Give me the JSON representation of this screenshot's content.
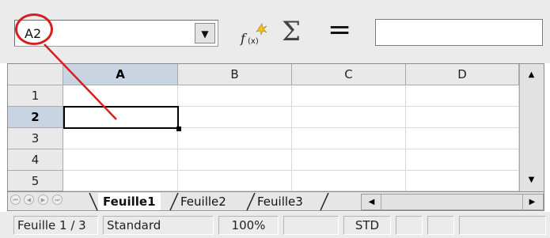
{
  "formula_bar": {
    "name_box_value": "A2",
    "dropdown_glyph": "▼",
    "function_wizard_icon": "f(x)-wizard-icon",
    "sum_glyph": "Σ",
    "equals_glyph": "=",
    "formula_value": ""
  },
  "grid": {
    "columns": [
      "A",
      "B",
      "C",
      "D"
    ],
    "rows": [
      "1",
      "2",
      "3",
      "4",
      "5"
    ],
    "selected_column": "A",
    "selected_row": "2",
    "active_cell": "A2"
  },
  "scrollbars": {
    "up": "▲",
    "down": "▼",
    "left": "◀",
    "right": "▶"
  },
  "tabs": {
    "nav": [
      "⏮",
      "◀",
      "▶",
      "⏭"
    ],
    "sheets": [
      "Feuille1",
      "Feuille2",
      "Feuille3"
    ],
    "active": "Feuille1"
  },
  "status_bar": {
    "sheet": "Feuille 1 / 3",
    "style": "Standard",
    "zoom": "100%",
    "mode": "",
    "selection_mode": "STD"
  },
  "colors": {
    "callout": "#d62020",
    "header_selected": "#c9d4e3",
    "header": "#e9e9e9"
  }
}
